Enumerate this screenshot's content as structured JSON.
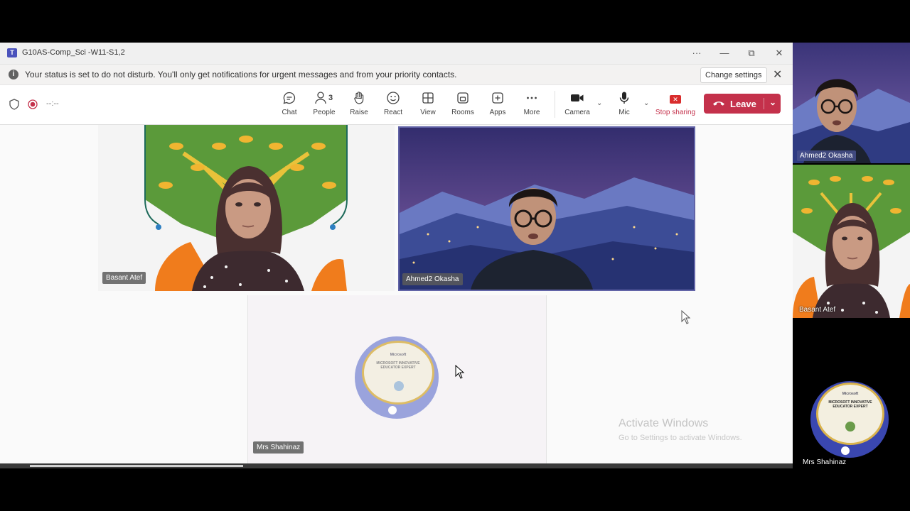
{
  "window": {
    "title": "G10AS-Comp_Sci -W11-S1,2",
    "controls": {
      "more": "···",
      "minimize": "—",
      "restore": "⧉",
      "close": "✕"
    }
  },
  "notification": {
    "message": "Your status is set to do not disturb. You'll only get notifications for urgent messages and from your priority contacts.",
    "change_settings": "Change settings",
    "close": "✕"
  },
  "toolbar": {
    "timer": "--:--",
    "people_count": "3",
    "items": [
      {
        "label": "Chat",
        "icon": "chat-icon"
      },
      {
        "label": "People",
        "icon": "people-icon"
      },
      {
        "label": "Raise",
        "icon": "hand-icon"
      },
      {
        "label": "React",
        "icon": "smile-icon"
      },
      {
        "label": "View",
        "icon": "grid-icon"
      },
      {
        "label": "Rooms",
        "icon": "rooms-icon"
      },
      {
        "label": "Apps",
        "icon": "plus-icon"
      },
      {
        "label": "More",
        "icon": "more-icon"
      },
      {
        "label": "Camera",
        "icon": "camera-icon"
      },
      {
        "label": "Mic",
        "icon": "mic-icon"
      },
      {
        "label": "Stop sharing",
        "icon": "stop-share-icon"
      }
    ],
    "leave_label": "Leave",
    "accent": "#c4314b"
  },
  "stage": {
    "participants": [
      {
        "name": "Basant Atef"
      },
      {
        "name": "Ahmed2 Okasha"
      },
      {
        "name": "Mrs Shahinaz"
      }
    ],
    "badge_text": "MICROSOFT INNOVATIVE EDUCATOR EXPERT",
    "badge_brand": "Microsoft",
    "activate_title": "Activate Windows",
    "activate_sub": "Go to Settings to activate Windows."
  },
  "side_panel": {
    "participants": [
      {
        "name": "Ahmed2 Okasha"
      },
      {
        "name": "Basant  Atef"
      },
      {
        "name": "Mrs Shahinaz"
      }
    ]
  }
}
